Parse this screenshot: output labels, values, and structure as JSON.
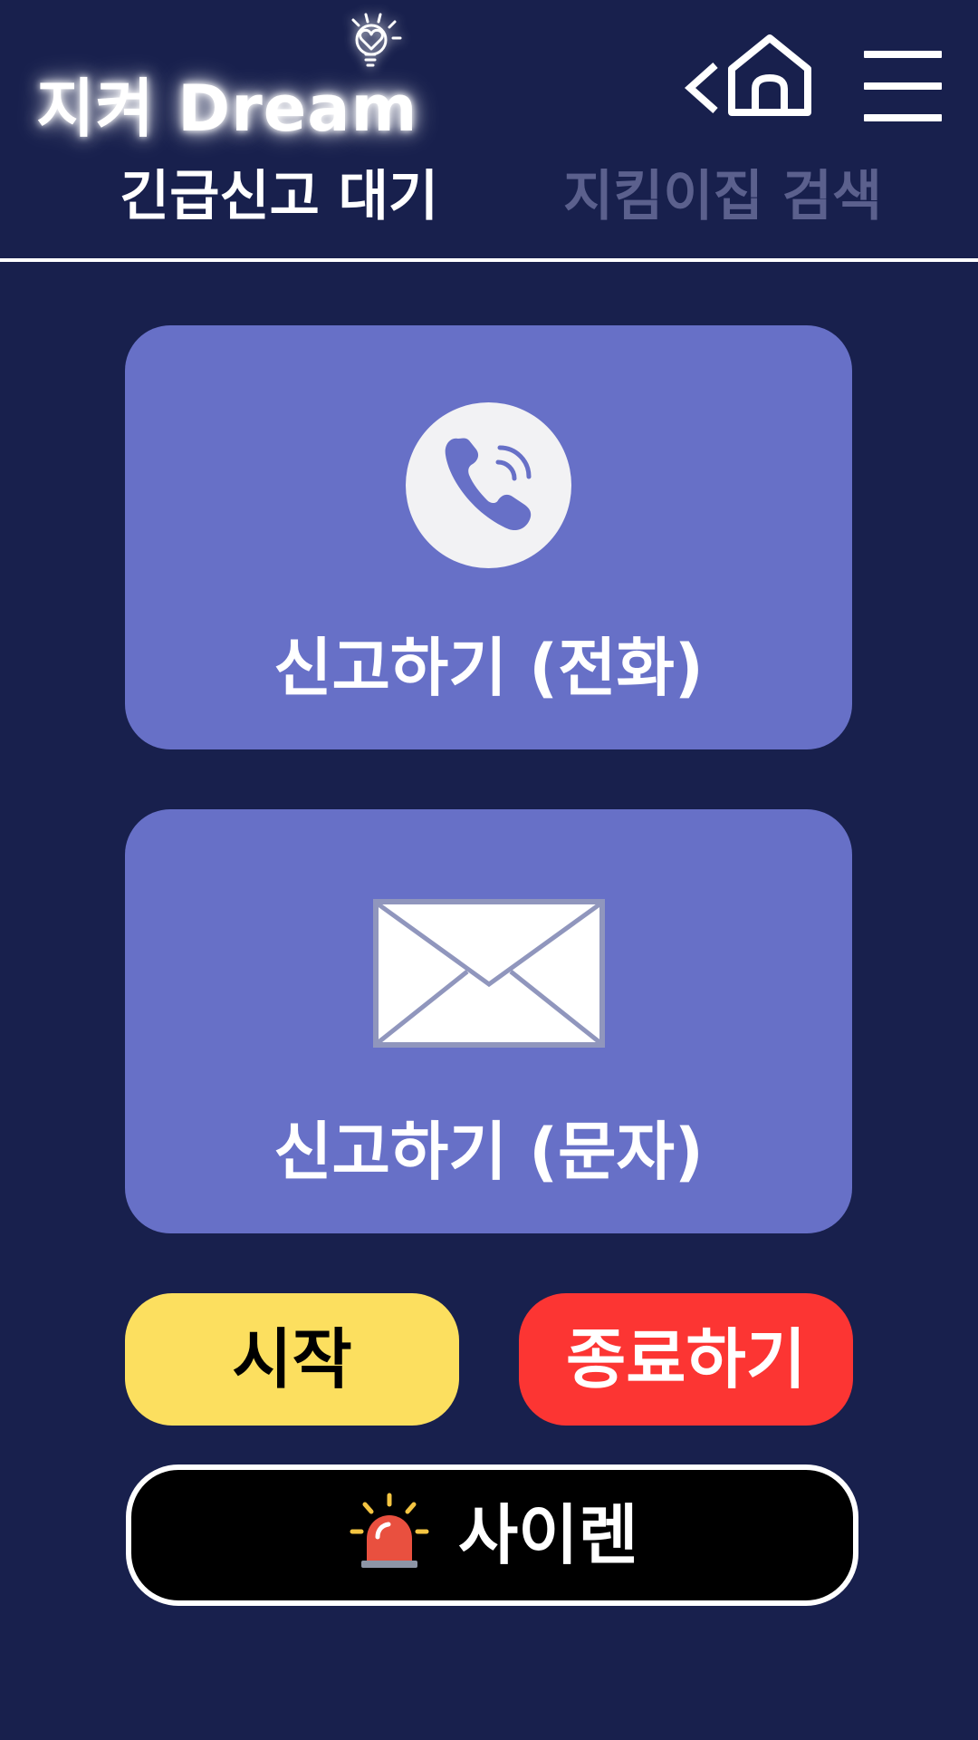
{
  "header": {
    "logo_text": "지켜 Dream",
    "icons": {
      "logo": "lightbulb-heart-icon",
      "back": "chevron-left-icon",
      "home": "home-icon",
      "menu": "hamburger-menu-icon"
    }
  },
  "tabs": [
    {
      "label": "긴급신고 대기",
      "active": true
    },
    {
      "label": "지킴이집 검색",
      "active": false
    }
  ],
  "report_cards": [
    {
      "label": "신고하기 (전화)",
      "icon": "phone-icon"
    },
    {
      "label": "신고하기 (문자)",
      "icon": "envelope-icon"
    }
  ],
  "buttons": {
    "start_label": "시작",
    "end_label": "종료하기",
    "siren_label": "사이렌",
    "siren_icon": "siren-icon"
  },
  "colors": {
    "background": "#18204d",
    "card": "#6770c7",
    "tab_inactive": "#5b608d",
    "start_button": "#fcdf5f",
    "end_button": "#fc3533",
    "siren_button": "#000000"
  }
}
